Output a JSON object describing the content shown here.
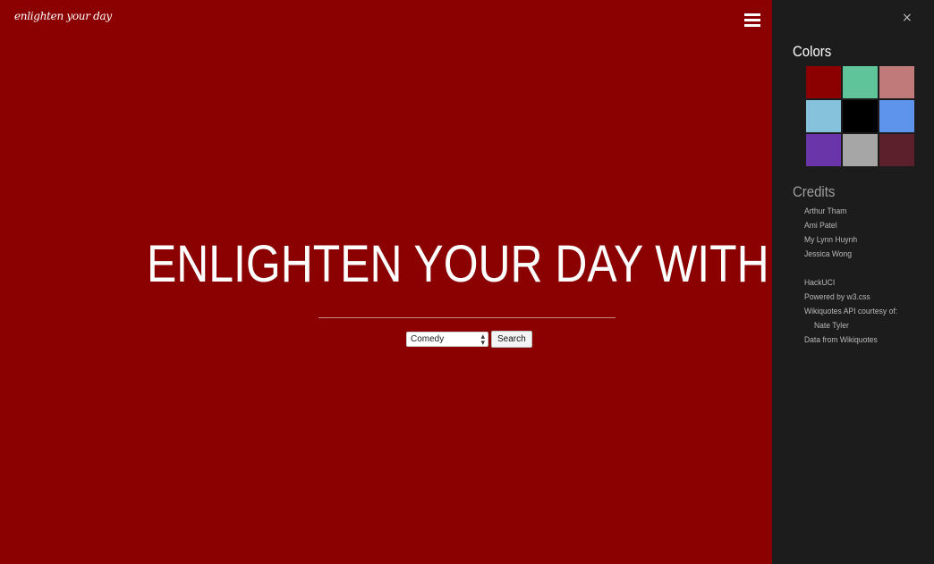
{
  "header": {
    "logo_text": "enlighten your day",
    "menu_icon": "hamburger-icon"
  },
  "main": {
    "background_color": "#8b0000",
    "title": "ENLIGHTEN YOUR DAY WITH ..",
    "category_select": {
      "selected": "Comedy"
    },
    "search_label": "Search"
  },
  "sidebar": {
    "close_label": "×",
    "colors_title": "Colors",
    "swatches": [
      {
        "color": "#8b0000"
      },
      {
        "color": "#5fc49a"
      },
      {
        "color": "#c17a7a"
      },
      {
        "color": "#86c2dc"
      },
      {
        "color": "#000000"
      },
      {
        "color": "#5f94ec"
      },
      {
        "color": "#6a35a8"
      },
      {
        "color": "#a6a6a6"
      },
      {
        "color": "#5c1f2c"
      }
    ],
    "credits_title": "Credits",
    "credits": [
      "Arthur Tham",
      "Ami Patel",
      "My Lynn Huynh",
      "Jessica Wong",
      "HackUCI",
      "Powered by w3.css",
      "Wikiquotes API courtesy of:",
      "Nate Tyler",
      "Data from Wikiquotes"
    ]
  }
}
